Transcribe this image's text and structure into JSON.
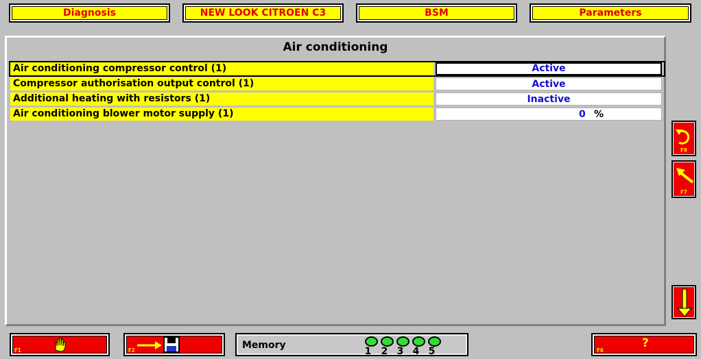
{
  "tabs": [
    {
      "label": "Diagnosis"
    },
    {
      "label": "NEW LOOK CITROEN C3"
    },
    {
      "label": "BSM"
    },
    {
      "label": "Parameters"
    }
  ],
  "panel": {
    "title": "Air conditioning",
    "rows": [
      {
        "label": "Air conditioning compressor control (1)",
        "value": "Active"
      },
      {
        "label": "Compressor authorisation output control (1)",
        "value": "Active"
      },
      {
        "label": "Additional heating with resistors (1)",
        "value": "Inactive"
      },
      {
        "label": "Air conditioning blower motor supply (1)",
        "value": "0",
        "unit": "%"
      }
    ]
  },
  "side_buttons": [
    {
      "icon": "refresh-icon",
      "key": "F9"
    },
    {
      "icon": "arrow-up-left-icon",
      "key": "F7"
    },
    {
      "icon": "arrow-down-icon"
    }
  ],
  "bottom": {
    "f1_key": "F1",
    "f1_icon": "hand-icon",
    "f2_key": "F2",
    "f2_icon": "save-to-disk-icon",
    "memory_label": "Memory",
    "memory_slots": [
      "1",
      "2",
      "3",
      "4",
      "5"
    ],
    "f6_key": "F6",
    "f6_label": "?"
  },
  "colors": {
    "background": "#c0c0c0",
    "tab_bg": "#ffff00",
    "tab_text": "#e00000",
    "value_text": "#1010d0",
    "button_red": "#ee0000",
    "led_green": "#33dd33"
  }
}
